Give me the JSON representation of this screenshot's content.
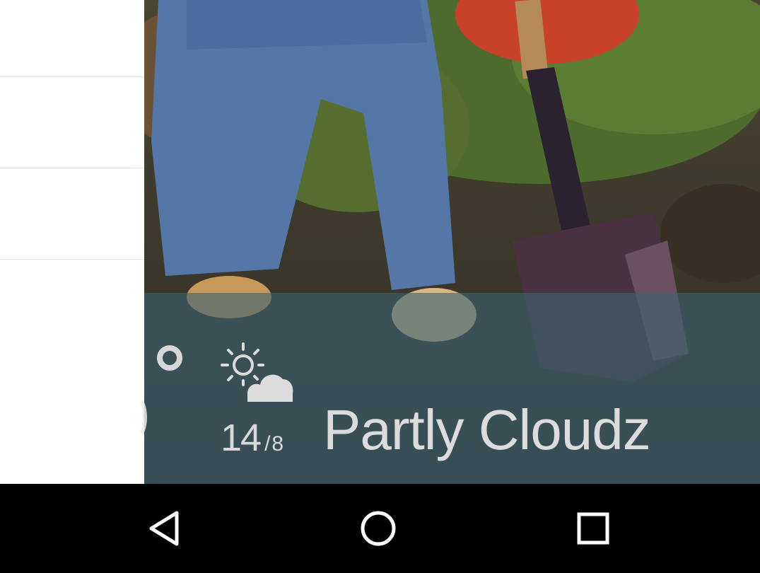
{
  "weather": {
    "temp_high": "14",
    "temp_separator": "/",
    "temp_low": "8",
    "condition": "Partly Cloudz",
    "icon": "partly-cloudy-icon"
  },
  "navbar": {
    "back_icon": "back-triangle-icon",
    "home_icon": "home-circle-icon",
    "recents_icon": "recents-square-icon"
  },
  "colors": {
    "overlay": "#3c6473",
    "text": "#dcdcdc",
    "navbar": "#000000",
    "panel": "#ffffff"
  }
}
